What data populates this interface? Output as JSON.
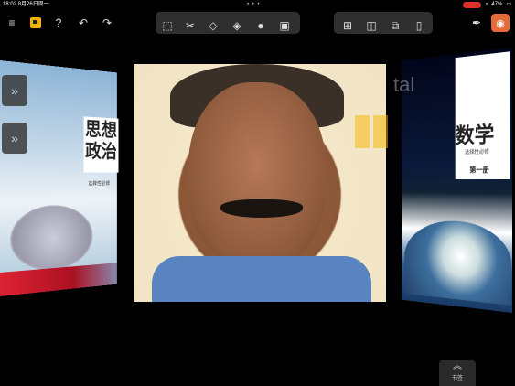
{
  "status_bar": {
    "time": "18:02",
    "date": "8月26日周一",
    "dots": "• • •",
    "battery": "47%"
  },
  "toolbar": {
    "left_icons": [
      "menu-icon",
      "app-logo-icon",
      "help-icon",
      "undo-icon",
      "redo-icon"
    ],
    "center_icons": [
      "select-icon",
      "cut-icon",
      "eraser-icon",
      "fill-icon",
      "circle-icon",
      "image-icon"
    ],
    "right_icons": [
      "insert-page-icon",
      "split-icon",
      "rotate-icon",
      "tablet-icon"
    ],
    "far_right_icons": [
      "pen-icon",
      "camera-icon"
    ],
    "accent_color": "#e46a3a"
  },
  "books": {
    "left_title": "思想政治",
    "left_subtitle": "选择性必修",
    "right_title": "数学",
    "right_subtitle": "选择性必修",
    "right_volume": "第一册"
  },
  "watermark": "tal",
  "side_buttons": [
    "»",
    "»"
  ],
  "pages_label": "书签",
  "pages_chevron": "︽"
}
